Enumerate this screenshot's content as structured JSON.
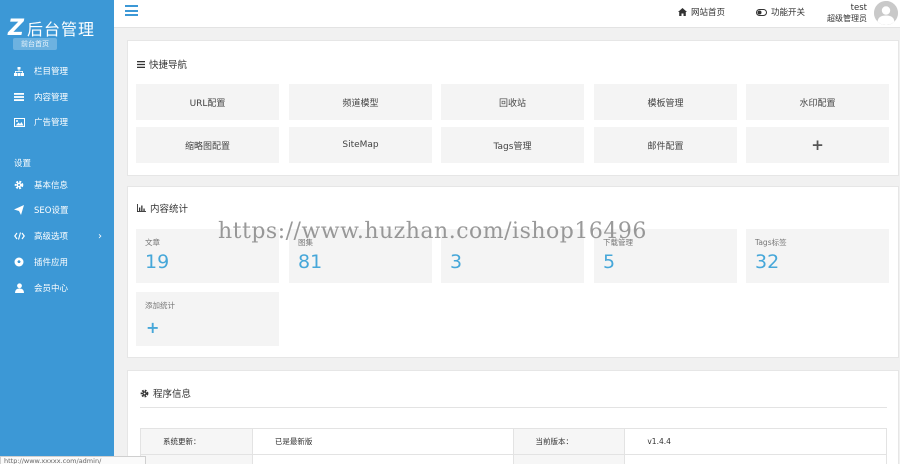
{
  "brand": {
    "logo_mark": "Z",
    "logo_text": "后台管理",
    "home_pill": "前台首页"
  },
  "sidebar": {
    "items": [
      {
        "label": "栏目管理",
        "icon": "sitemap-icon"
      },
      {
        "label": "内容管理",
        "icon": "list-icon"
      },
      {
        "label": "广告管理",
        "icon": "image-icon"
      }
    ],
    "section_label": "设置",
    "settings_items": [
      {
        "label": "基本信息",
        "icon": "gear-icon"
      },
      {
        "label": "SEO设置",
        "icon": "send-icon"
      },
      {
        "label": "高级选项",
        "icon": "code-icon",
        "chevron": "›"
      },
      {
        "label": "插件应用",
        "icon": "soccer-icon"
      },
      {
        "label": "会员中心",
        "icon": "user-icon"
      }
    ]
  },
  "topbar": {
    "site_home": "网站首页",
    "function_toggle": "功能开关",
    "user_name": "test",
    "user_role": "超级管理员"
  },
  "quick_nav": {
    "title": "快捷导航",
    "tiles": [
      "URL配置",
      "频道模型",
      "回收站",
      "模板管理",
      "水印配置",
      "缩略图配置",
      "SiteMap",
      "Tags管理",
      "邮件配置",
      "+"
    ]
  },
  "stats": {
    "title": "内容统计",
    "cards": [
      {
        "label": "文章",
        "value": "19"
      },
      {
        "label": "图集",
        "value": "81"
      },
      {
        "label": "",
        "value": "3"
      },
      {
        "label": "下载管理",
        "value": "5"
      },
      {
        "label": "Tags标签",
        "value": "32"
      }
    ],
    "add_card": {
      "label": "添加统计",
      "value": "+"
    }
  },
  "program_info": {
    "title": "程序信息",
    "rows": [
      {
        "k1": "系统更新：",
        "v1": "已是最新版",
        "k2": "当前版本：",
        "v2": "v1.4.4"
      }
    ]
  },
  "watermark": "https://www.huzhan.com/ishop16496",
  "statusbar": "http://www.xxxxx.com/admin/",
  "colors": {
    "sidebar": "#3c98d6",
    "accent": "#46a7d9",
    "tile_bg": "#f4f4f4",
    "page_bg": "#f1f1f1"
  }
}
